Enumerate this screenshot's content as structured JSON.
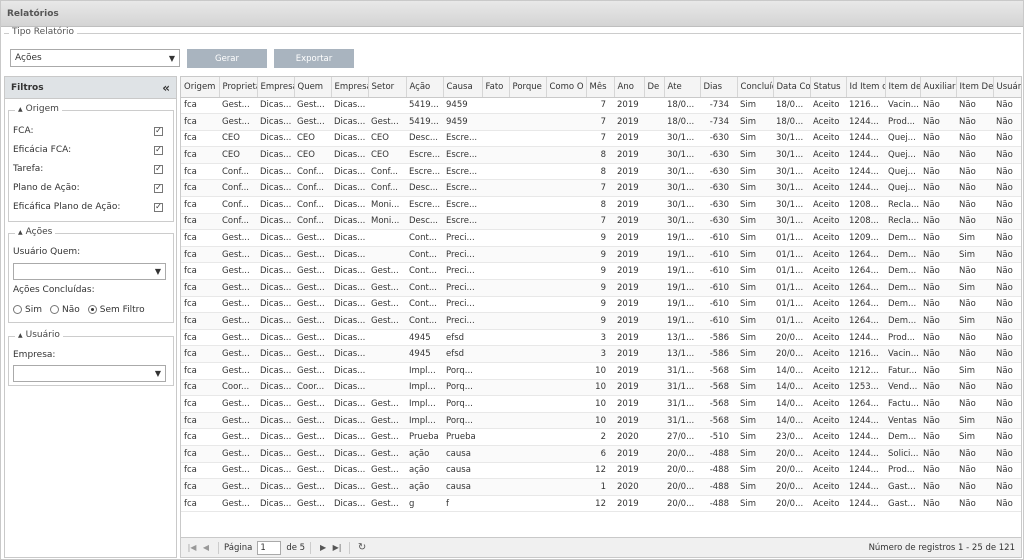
{
  "title": "Relatórios",
  "tipo": {
    "legend": "Tipo Relatório",
    "selected": "Ações",
    "gerar": "Gerar",
    "exportar": "Exportar"
  },
  "filtros": {
    "title": "Filtros",
    "collapse_glyph": "«",
    "origem": {
      "legend": "Origem",
      "items": [
        {
          "label": "FCA:",
          "checked": true
        },
        {
          "label": "Eficácia FCA:",
          "checked": true
        },
        {
          "label": "Tarefa:",
          "checked": true
        },
        {
          "label": "Plano de Ação:",
          "checked": true
        },
        {
          "label": "Eficáfica Plano de Ação:",
          "checked": true
        }
      ]
    },
    "acoes": {
      "legend": "Ações",
      "usuario_quem_label": "Usuário Quem:",
      "usuario_quem_value": "",
      "concluidas_label": "Ações Concluídas:",
      "radios": [
        {
          "label": "Sim",
          "selected": false
        },
        {
          "label": "Não",
          "selected": false
        },
        {
          "label": "Sem Filtro",
          "selected": true
        }
      ]
    },
    "usuario": {
      "legend": "Usuário",
      "empresa_label": "Empresa:",
      "empresa_value": ""
    }
  },
  "grid": {
    "columns": [
      "Origem",
      "Proprietá",
      "Empresa",
      "Quem",
      "Empresa",
      "Setor",
      "Ação",
      "Causa",
      "Fato",
      "Porque",
      "Como O",
      "Mês",
      "Ano",
      "De",
      "Ate",
      "Dias",
      "Concluíd",
      "Data Co",
      "Status",
      "Id Item c",
      "Item de",
      "Auxiliar",
      "Item De",
      "Usuário"
    ],
    "rows": [
      [
        "fca",
        "Gest...",
        "Dicas...",
        "Gest...",
        "Dicas...",
        "",
        "5419...",
        "9459",
        "",
        "",
        "",
        "7",
        "2019",
        "",
        "18/0...",
        "-734",
        "Sim",
        "18/0...",
        "Aceito",
        "1216...",
        "Vacin...",
        "Não",
        "Não",
        "Não"
      ],
      [
        "fca",
        "Gest...",
        "Dicas...",
        "Gest...",
        "Dicas...",
        "Gest...",
        "5419...",
        "9459",
        "",
        "",
        "",
        "7",
        "2019",
        "",
        "18/0...",
        "-734",
        "Sim",
        "18/0...",
        "Aceito",
        "1244...",
        "Prod...",
        "Não",
        "Não",
        "Não"
      ],
      [
        "fca",
        "CEO",
        "Dicas...",
        "CEO",
        "Dicas...",
        "CEO",
        "Desc...",
        "Escre...",
        "",
        "",
        "",
        "7",
        "2019",
        "",
        "30/1...",
        "-630",
        "Sim",
        "30/1...",
        "Aceito",
        "1244...",
        "Quej...",
        "Não",
        "Não",
        "Não"
      ],
      [
        "fca",
        "CEO",
        "Dicas...",
        "CEO",
        "Dicas...",
        "CEO",
        "Escre...",
        "Escre...",
        "",
        "",
        "",
        "8",
        "2019",
        "",
        "30/1...",
        "-630",
        "Sim",
        "30/1...",
        "Aceito",
        "1244...",
        "Quej...",
        "Não",
        "Não",
        "Não"
      ],
      [
        "fca",
        "Conf...",
        "Dicas...",
        "Conf...",
        "Dicas...",
        "Conf...",
        "Escre...",
        "Escre...",
        "",
        "",
        "",
        "8",
        "2019",
        "",
        "30/1...",
        "-630",
        "Sim",
        "30/1...",
        "Aceito",
        "1244...",
        "Quej...",
        "Não",
        "Não",
        "Não"
      ],
      [
        "fca",
        "Conf...",
        "Dicas...",
        "Conf...",
        "Dicas...",
        "Conf...",
        "Desc...",
        "Escre...",
        "",
        "",
        "",
        "7",
        "2019",
        "",
        "30/1...",
        "-630",
        "Sim",
        "30/1...",
        "Aceito",
        "1244...",
        "Quej...",
        "Não",
        "Não",
        "Não"
      ],
      [
        "fca",
        "Conf...",
        "Dicas...",
        "Conf...",
        "Dicas...",
        "Moni...",
        "Escre...",
        "Escre...",
        "",
        "",
        "",
        "8",
        "2019",
        "",
        "30/1...",
        "-630",
        "Sim",
        "30/1...",
        "Aceito",
        "1208...",
        "Recla...",
        "Não",
        "Não",
        "Não"
      ],
      [
        "fca",
        "Conf...",
        "Dicas...",
        "Conf...",
        "Dicas...",
        "Moni...",
        "Desc...",
        "Escre...",
        "",
        "",
        "",
        "7",
        "2019",
        "",
        "30/1...",
        "-630",
        "Sim",
        "30/1...",
        "Aceito",
        "1208...",
        "Recla...",
        "Não",
        "Não",
        "Não"
      ],
      [
        "fca",
        "Gest...",
        "Dicas...",
        "Gest...",
        "Dicas...",
        "",
        "Cont...",
        "Preci...",
        "",
        "",
        "",
        "9",
        "2019",
        "",
        "19/1...",
        "-610",
        "Sim",
        "01/1...",
        "Aceito",
        "1209...",
        "Dem...",
        "Não",
        "Sim",
        "Não"
      ],
      [
        "fca",
        "Gest...",
        "Dicas...",
        "Gest...",
        "Dicas...",
        "",
        "Cont...",
        "Preci...",
        "",
        "",
        "",
        "9",
        "2019",
        "",
        "19/1...",
        "-610",
        "Sim",
        "01/1...",
        "Aceito",
        "1264...",
        "Dem...",
        "Não",
        "Sim",
        "Não"
      ],
      [
        "fca",
        "Gest...",
        "Dicas...",
        "Gest...",
        "Dicas...",
        "Gest...",
        "Cont...",
        "Preci...",
        "",
        "",
        "",
        "9",
        "2019",
        "",
        "19/1...",
        "-610",
        "Sim",
        "01/1...",
        "Aceito",
        "1264...",
        "Dem...",
        "Não",
        "Não",
        "Não"
      ],
      [
        "fca",
        "Gest...",
        "Dicas...",
        "Gest...",
        "Dicas...",
        "Gest...",
        "Cont...",
        "Preci...",
        "",
        "",
        "",
        "9",
        "2019",
        "",
        "19/1...",
        "-610",
        "Sim",
        "01/1...",
        "Aceito",
        "1264...",
        "Dem...",
        "Não",
        "Sim",
        "Não"
      ],
      [
        "fca",
        "Gest...",
        "Dicas...",
        "Gest...",
        "Dicas...",
        "Gest...",
        "Cont...",
        "Preci...",
        "",
        "",
        "",
        "9",
        "2019",
        "",
        "19/1...",
        "-610",
        "Sim",
        "01/1...",
        "Aceito",
        "1264...",
        "Dem...",
        "Não",
        "Não",
        "Não"
      ],
      [
        "fca",
        "Gest...",
        "Dicas...",
        "Gest...",
        "Dicas...",
        "Gest...",
        "Cont...",
        "Preci...",
        "",
        "",
        "",
        "9",
        "2019",
        "",
        "19/1...",
        "-610",
        "Sim",
        "01/1...",
        "Aceito",
        "1264...",
        "Dem...",
        "Não",
        "Sim",
        "Não"
      ],
      [
        "fca",
        "Gest...",
        "Dicas...",
        "Gest...",
        "Dicas...",
        "",
        "4945",
        "efsd",
        "",
        "",
        "",
        "3",
        "2019",
        "",
        "13/1...",
        "-586",
        "Sim",
        "20/0...",
        "Aceito",
        "1244...",
        "Prod...",
        "Não",
        "Não",
        "Não"
      ],
      [
        "fca",
        "Gest...",
        "Dicas...",
        "Gest...",
        "Dicas...",
        "",
        "4945",
        "efsd",
        "",
        "",
        "",
        "3",
        "2019",
        "",
        "13/1...",
        "-586",
        "Sim",
        "20/0...",
        "Aceito",
        "1216...",
        "Vacin...",
        "Não",
        "Não",
        "Não"
      ],
      [
        "fca",
        "Gest...",
        "Dicas...",
        "Gest...",
        "Dicas...",
        "",
        "Impl...",
        "Porq...",
        "",
        "",
        "",
        "10",
        "2019",
        "",
        "31/1...",
        "-568",
        "Sim",
        "14/0...",
        "Aceito",
        "1212...",
        "Fatur...",
        "Não",
        "Sim",
        "Não"
      ],
      [
        "fca",
        "Coor...",
        "Dicas...",
        "Coor...",
        "Dicas...",
        "",
        "Impl...",
        "Porq...",
        "",
        "",
        "",
        "10",
        "2019",
        "",
        "31/1...",
        "-568",
        "Sim",
        "14/0...",
        "Aceito",
        "1253...",
        "Vend...",
        "Não",
        "Não",
        "Não"
      ],
      [
        "fca",
        "Gest...",
        "Dicas...",
        "Gest...",
        "Dicas...",
        "Gest...",
        "Impl...",
        "Porq...",
        "",
        "",
        "",
        "10",
        "2019",
        "",
        "31/1...",
        "-568",
        "Sim",
        "14/0...",
        "Aceito",
        "1264...",
        "Factu...",
        "Não",
        "Não",
        "Não"
      ],
      [
        "fca",
        "Gest...",
        "Dicas...",
        "Gest...",
        "Dicas...",
        "Gest...",
        "Impl...",
        "Porq...",
        "",
        "",
        "",
        "10",
        "2019",
        "",
        "31/1...",
        "-568",
        "Sim",
        "14/0...",
        "Aceito",
        "1244...",
        "Ventas",
        "Não",
        "Sim",
        "Não"
      ],
      [
        "fca",
        "Gest...",
        "Dicas...",
        "Gest...",
        "Dicas...",
        "Gest...",
        "Prueba",
        "Prueba",
        "",
        "",
        "",
        "2",
        "2020",
        "",
        "27/0...",
        "-510",
        "Sim",
        "23/0...",
        "Aceito",
        "1244...",
        "Dem...",
        "Não",
        "Sim",
        "Não"
      ],
      [
        "fca",
        "Gest...",
        "Dicas...",
        "Gest...",
        "Dicas...",
        "Gest...",
        "ação",
        "causa",
        "",
        "",
        "",
        "6",
        "2019",
        "",
        "20/0...",
        "-488",
        "Sim",
        "20/0...",
        "Aceito",
        "1244...",
        "Solici...",
        "Não",
        "Não",
        "Não"
      ],
      [
        "fca",
        "Gest...",
        "Dicas...",
        "Gest...",
        "Dicas...",
        "Gest...",
        "ação",
        "causa",
        "",
        "",
        "",
        "12",
        "2019",
        "",
        "20/0...",
        "-488",
        "Sim",
        "20/0...",
        "Aceito",
        "1244...",
        "Prod...",
        "Não",
        "Não",
        "Não"
      ],
      [
        "fca",
        "Gest...",
        "Dicas...",
        "Gest...",
        "Dicas...",
        "Gest...",
        "ação",
        "causa",
        "",
        "",
        "",
        "1",
        "2020",
        "",
        "20/0...",
        "-488",
        "Sim",
        "20/0...",
        "Aceito",
        "1244...",
        "Gast...",
        "Não",
        "Não",
        "Não"
      ],
      [
        "fca",
        "Gest...",
        "Dicas...",
        "Gest...",
        "Dicas...",
        "Gest...",
        "g",
        "f",
        "",
        "",
        "",
        "12",
        "2019",
        "",
        "20/0...",
        "-488",
        "Sim",
        "20/0...",
        "Aceito",
        "1244...",
        "Gast...",
        "Não",
        "Não",
        "Não"
      ]
    ]
  },
  "pager": {
    "page_label": "Página",
    "page_value": "1",
    "of_label": "de 5",
    "records": "Número de registros 1 - 25 de 121"
  }
}
